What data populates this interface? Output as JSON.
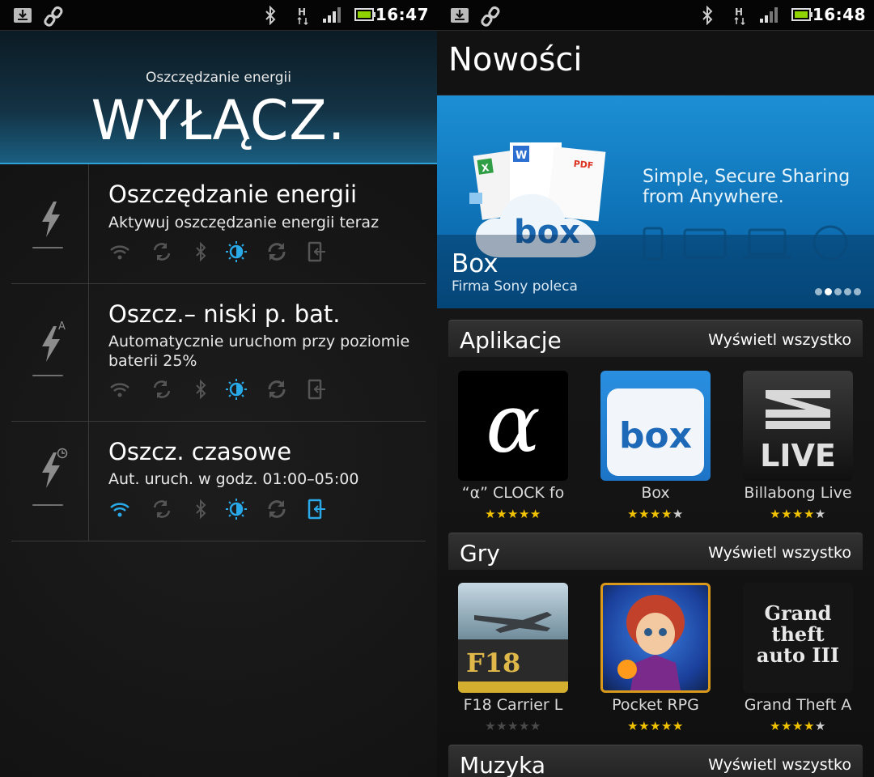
{
  "left": {
    "status_time": "16:47",
    "header_subtitle": "Oszczędzanie energii",
    "header_title": "WYŁĄCZ.",
    "modes": [
      {
        "title": "Oszczędzanie energii",
        "description": "Aktywuj oszczędzanie energii teraz"
      },
      {
        "title": "Oszcz.– niski p. bat.",
        "description": "Automatycznie uruchom przy poziomie baterii 25%"
      },
      {
        "title": "Oszcz. czasowe",
        "description": "Aut. uruch. w godz. 01:00–05:00"
      }
    ]
  },
  "right": {
    "status_time": "16:48",
    "page_title": "Nowości",
    "banner": {
      "headline": "Simple, Secure Sharing from Anywhere.",
      "logo_text": "box",
      "title": "Box",
      "subtitle": "Firma Sony poleca",
      "page_count": 5,
      "active_page": 2
    },
    "sections": [
      {
        "title": "Aplikacje",
        "view_all": "Wyświetl wszystko",
        "apps": [
          {
            "name": "“α” CLOCK fo",
            "rating": 4.5,
            "tile_text": "α"
          },
          {
            "name": "Box",
            "rating": 4,
            "tile_text": "box"
          },
          {
            "name": "Billabong Live",
            "rating": 4,
            "tile_text": "LIVE"
          }
        ]
      },
      {
        "title": "Gry",
        "view_all": "Wyświetl wszystko",
        "apps": [
          {
            "name": "F18 Carrier L",
            "rating": 0,
            "tile_text": "F18"
          },
          {
            "name": "Pocket RPG",
            "rating": 4.5,
            "tile_text": ""
          },
          {
            "name": "Grand Theft A",
            "rating": 3.5,
            "tile_text": "Grand theft auto III"
          }
        ]
      },
      {
        "title": "Muzyka",
        "view_all": "Wyświetl wszystko"
      }
    ]
  },
  "colors": {
    "accent": "#2da0d6",
    "star": "#f2c300",
    "icon_active": "#29a9e8",
    "icon_inactive": "#5a5a5a"
  }
}
